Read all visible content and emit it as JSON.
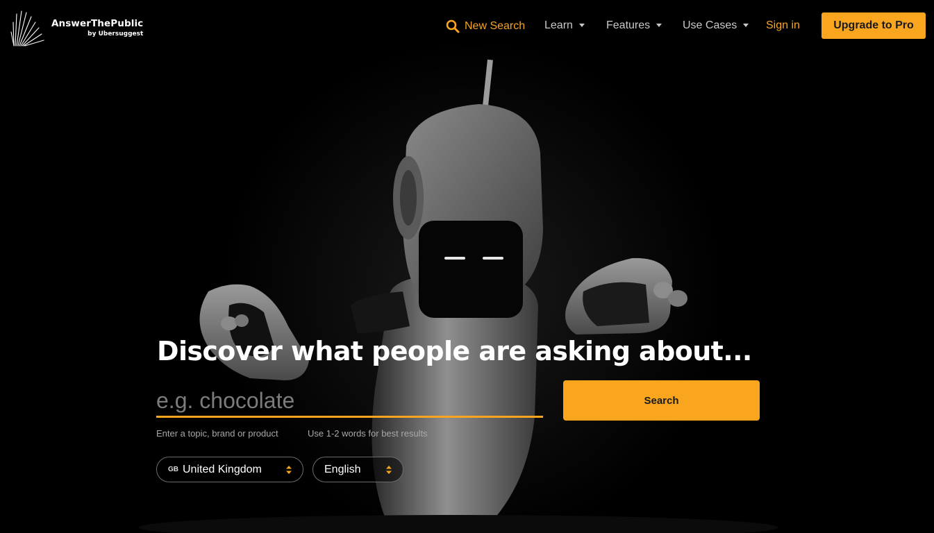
{
  "brand": {
    "name": "AnswerThePublic",
    "tagline": "by Ubersuggest"
  },
  "nav": {
    "new_search": "New Search",
    "learn": "Learn",
    "features": "Features",
    "use_cases": "Use Cases",
    "sign_in": "Sign in",
    "upgrade": "Upgrade to Pro"
  },
  "hero": {
    "headline": "Discover what people are asking about...",
    "search_placeholder": "e.g. chocolate",
    "search_value": "",
    "search_button": "Search",
    "hint_topic": "Enter a topic, brand or product",
    "hint_words": "Use 1-2 words for best results",
    "country_code": "GB",
    "country": "United Kingdom",
    "language": "English"
  },
  "colors": {
    "accent": "#f9a51d",
    "background": "#000000"
  },
  "icons": {
    "logo": "answerthepublic-burst-logo",
    "new_search": "search-icon",
    "dropdown": "caret-down-icon",
    "select": "up-down-arrows-icon"
  }
}
